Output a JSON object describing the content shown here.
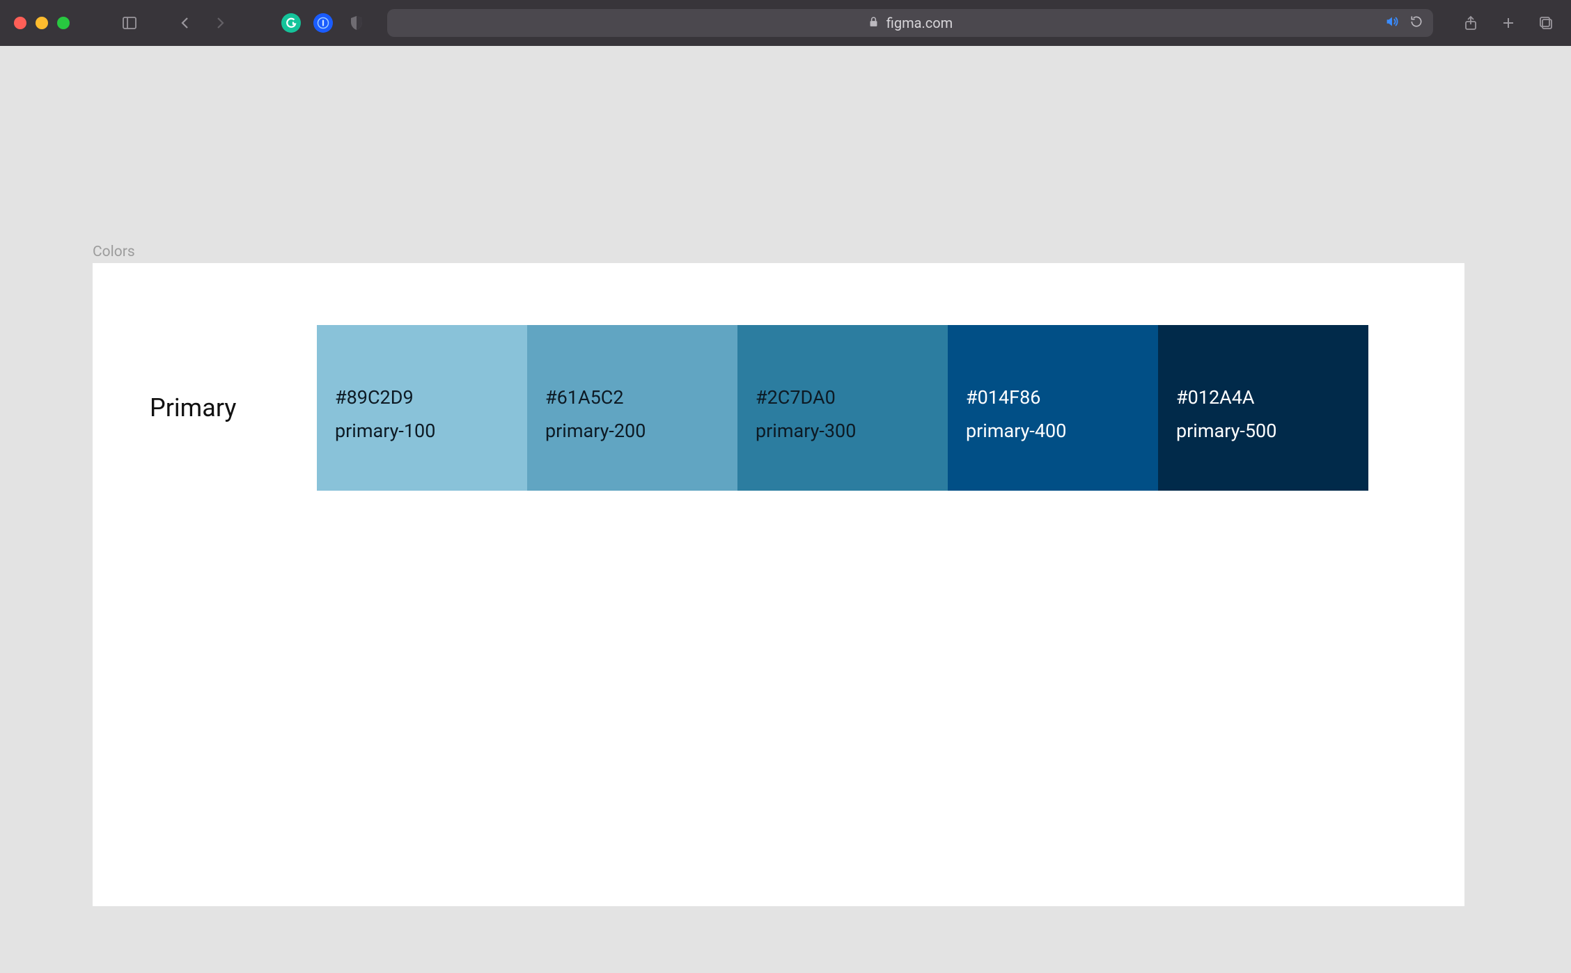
{
  "browser": {
    "url_display": "figma.com"
  },
  "frame": {
    "label": "Colors"
  },
  "palette": {
    "title": "Primary",
    "swatches": [
      {
        "hex": "#89C2D9",
        "token": "primary-100",
        "bg": "#89C2D9",
        "text": "dark"
      },
      {
        "hex": "#61A5C2",
        "token": "primary-200",
        "bg": "#61A5C2",
        "text": "dark"
      },
      {
        "hex": "#2C7DA0",
        "token": "primary-300",
        "bg": "#2C7DA0",
        "text": "dark"
      },
      {
        "hex": "#014F86",
        "token": "primary-400",
        "bg": "#014F86",
        "text": "light"
      },
      {
        "hex": "#012A4A",
        "token": "primary-500",
        "bg": "#012A4A",
        "text": "light"
      }
    ]
  }
}
